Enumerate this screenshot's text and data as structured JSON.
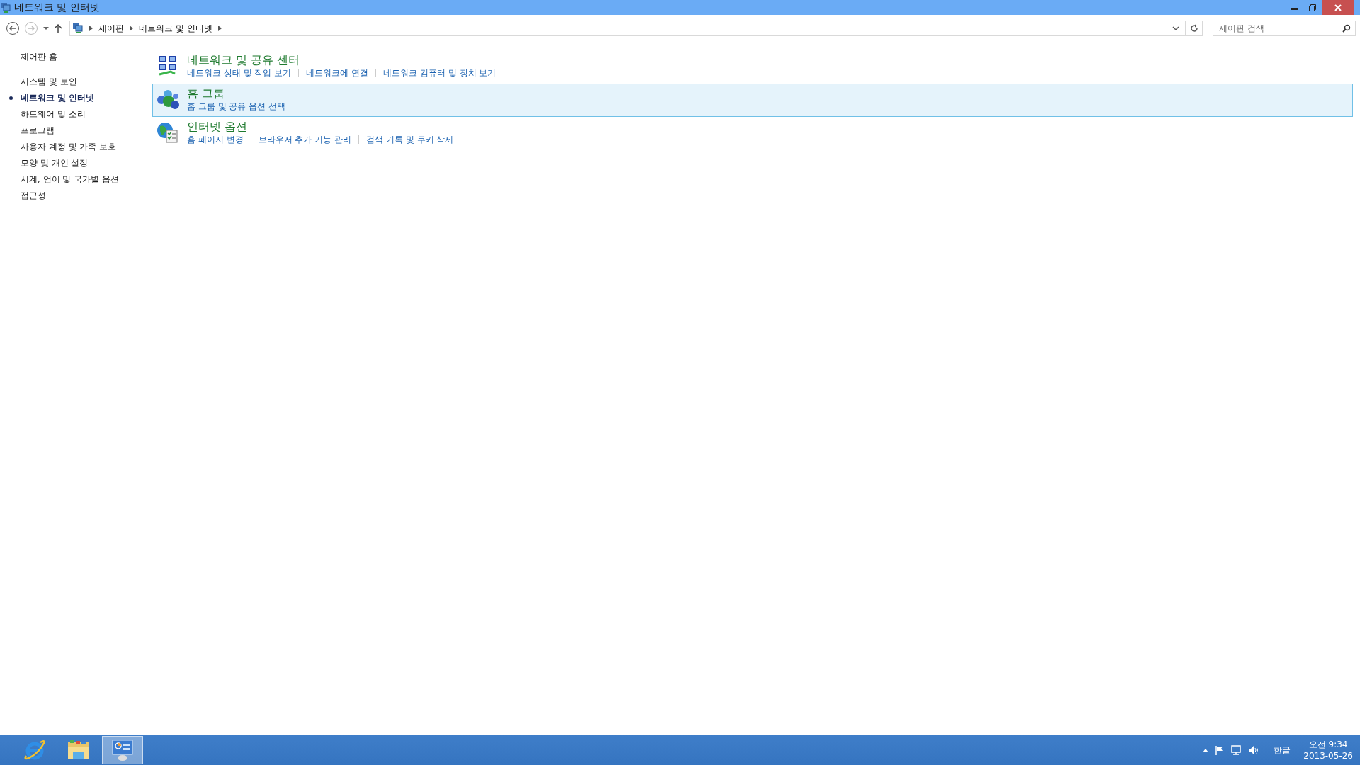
{
  "window": {
    "title": "네트워크 및 인터넷"
  },
  "address_bar": {
    "crumbs": [
      "제어판",
      "네트워크 및 인터넷"
    ]
  },
  "search": {
    "placeholder": "제어판 검색"
  },
  "sidebar": {
    "home": "제어판 홈",
    "items": [
      {
        "label": "시스템 및 보안",
        "selected": false
      },
      {
        "label": "네트워크 및 인터넷",
        "selected": true
      },
      {
        "label": "하드웨어 및 소리",
        "selected": false
      },
      {
        "label": "프로그램",
        "selected": false
      },
      {
        "label": "사용자 계정 및 가족 보호",
        "selected": false
      },
      {
        "label": "모양 및 개인 설정",
        "selected": false
      },
      {
        "label": "시계, 언어 및 국가별 옵션",
        "selected": false
      },
      {
        "label": "접근성",
        "selected": false
      }
    ]
  },
  "categories": [
    {
      "kind": "network",
      "title": "네트워크 및 공유 센터",
      "selected": false,
      "links": [
        "네트워크 상태 및 작업 보기",
        "네트워크에 연결",
        "네트워크 컴퓨터 및 장치 보기"
      ]
    },
    {
      "kind": "homegroup",
      "title": "홈 그룹",
      "selected": true,
      "links": [
        "홈 그룹 및 공유 옵션 선택"
      ]
    },
    {
      "kind": "internet",
      "title": "인터넷 옵션",
      "selected": false,
      "links": [
        "홈 페이지 변경",
        "브라우저 추가 기능 관리",
        "검색 기록 및 쿠키 삭제"
      ]
    }
  ],
  "taskbar": {
    "apps": [
      {
        "kind": "browser",
        "selected": false
      },
      {
        "kind": "explorer",
        "selected": false
      },
      {
        "kind": "control-panel",
        "selected": true
      }
    ],
    "tray": {
      "ime": "한글",
      "time": "오전 9:34",
      "date": "2013-05-26"
    }
  }
}
